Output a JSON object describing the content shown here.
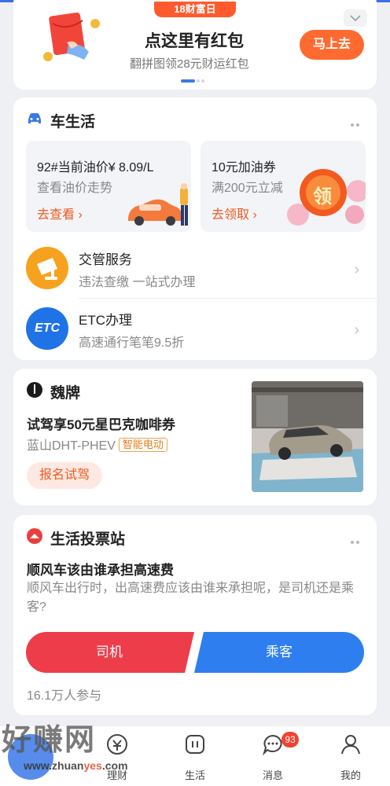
{
  "banner": {
    "tag": "18财富日",
    "title": "点这里有红包",
    "subtitle": "翻拼图领28元财运红包",
    "button": "马上去",
    "collapse_icon": "chevron-down-icon"
  },
  "car_life": {
    "title": "车生活",
    "icon": "car-icon",
    "left_card": {
      "title": "92#当前油价¥ 8.09/L",
      "subtitle": "查看油价走势",
      "link": "去查看"
    },
    "right_card": {
      "title": "10元加油券",
      "subtitle": "满200元立减",
      "link": "去领取",
      "coin_text": "领"
    },
    "services": [
      {
        "name": "交管服务",
        "desc": "违法查缴  一站式办理",
        "icon": "camera-icon"
      },
      {
        "name": "ETC办理",
        "desc": "高速通行笔笔9.5折",
        "icon_text": "ETC"
      }
    ]
  },
  "ad": {
    "brand": "魏牌",
    "title": "试驾享50元星巴克咖啡券",
    "model": "蓝山DHT-PHEV",
    "badge": "智能电动",
    "button": "报名试驾"
  },
  "vote": {
    "title": "生活投票站",
    "question": "顺风车该由谁承担高速费",
    "description": "顺风车出行时，出高速费应该由谁来承担呢，是司机还是乘客?",
    "option_a": "司机",
    "option_b": "乘客",
    "participants": "16.1万人参与"
  },
  "tabs": [
    {
      "label": "理财",
      "icon": "finance-icon"
    },
    {
      "label": "生活",
      "icon": "life-icon"
    },
    {
      "label": "消息",
      "icon": "message-icon"
    },
    {
      "label": "我的",
      "icon": "profile-icon"
    }
  ],
  "messages_badge": "93",
  "watermark": {
    "text": "好赚网",
    "url_prefix": "www.zhuan",
    "url_highlight": "yes",
    "url_suffix": ".com"
  },
  "colors": {
    "accent": "#ff6a30",
    "link": "#f05a22",
    "blue": "#3a78e8",
    "red_vote": "#ee3d4a",
    "blue_vote": "#2e7ef0"
  }
}
